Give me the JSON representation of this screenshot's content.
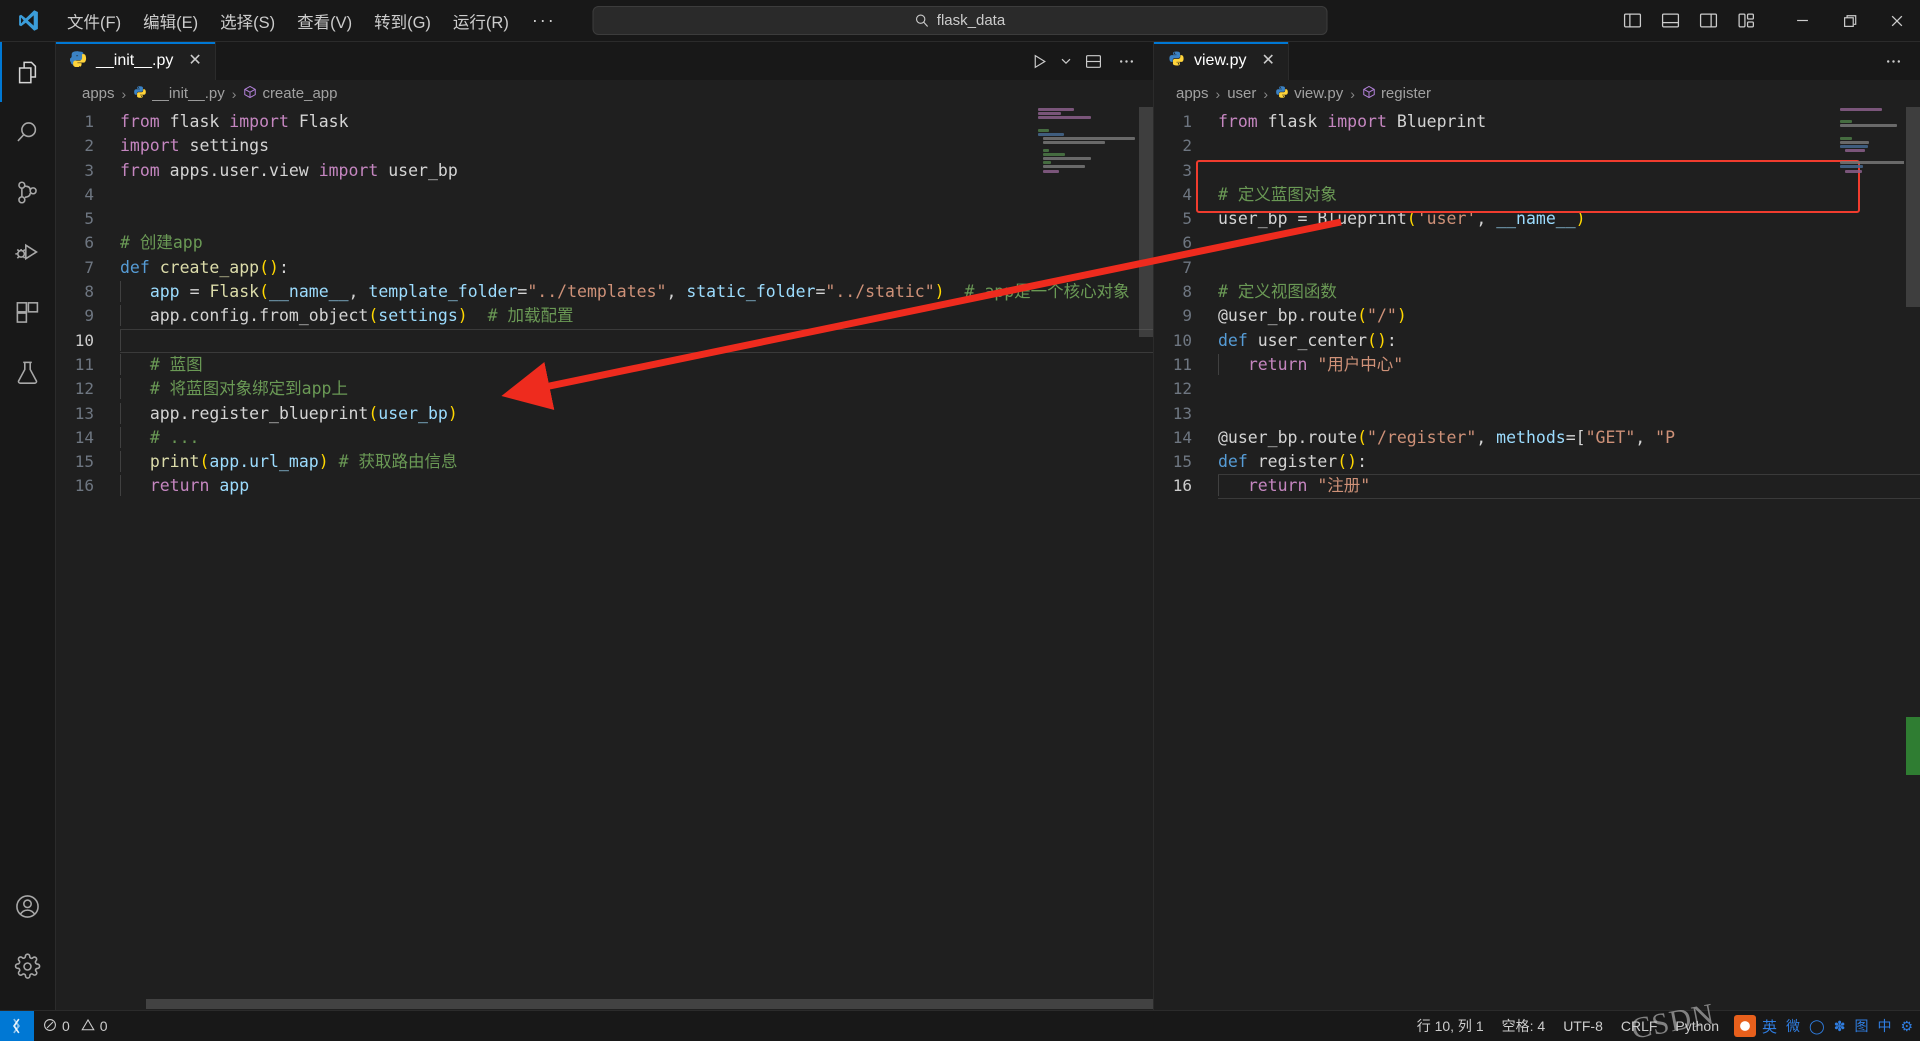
{
  "titlebar": {
    "logo_icon": "vscode-logo-icon",
    "menu": [
      {
        "label": "文件(F)",
        "name": "menu-file"
      },
      {
        "label": "编辑(E)",
        "name": "menu-edit"
      },
      {
        "label": "选择(S)",
        "name": "menu-selection"
      },
      {
        "label": "查看(V)",
        "name": "menu-view"
      },
      {
        "label": "转到(G)",
        "name": "menu-goto"
      },
      {
        "label": "运行(R)",
        "name": "menu-run"
      }
    ],
    "more_label": "···",
    "back_arrow": "←",
    "forward_arrow": "→",
    "command_center": {
      "icon": "search-icon",
      "text": "flask_data"
    },
    "layout_buttons": [
      {
        "name": "toggle-primary-sidebar-icon"
      },
      {
        "name": "toggle-panel-icon"
      },
      {
        "name": "toggle-secondary-sidebar-icon"
      },
      {
        "name": "customize-layout-icon"
      }
    ],
    "window_controls": {
      "minimize": "—",
      "maximize": "❐",
      "close": "✕"
    }
  },
  "activitybar": {
    "items": [
      {
        "name": "activity-explorer",
        "icon": "files-icon",
        "active": true
      },
      {
        "name": "activity-search",
        "icon": "search-icon",
        "active": false
      },
      {
        "name": "activity-source-control",
        "icon": "source-control-icon",
        "active": false
      },
      {
        "name": "activity-run-debug",
        "icon": "run-and-debug-icon",
        "active": false
      },
      {
        "name": "activity-extensions",
        "icon": "extensions-icon",
        "active": false
      },
      {
        "name": "activity-testing",
        "icon": "beaker-icon",
        "active": false
      }
    ],
    "bottom": [
      {
        "name": "activity-accounts",
        "icon": "account-icon"
      },
      {
        "name": "activity-settings",
        "icon": "gear-icon"
      }
    ]
  },
  "left_pane": {
    "tab": {
      "label": "__init__.py",
      "icon": "python-file-icon",
      "close": "✕"
    },
    "actions": [
      {
        "name": "run-python-file-button",
        "icon": "play-icon"
      },
      {
        "name": "run-dropdown-button",
        "icon": "chevron-down-icon"
      },
      {
        "name": "split-editor-down-button",
        "icon": "split-editor-icon"
      },
      {
        "name": "more-actions-button",
        "icon": "ellipsis-icon"
      }
    ],
    "breadcrumb": [
      {
        "label": "apps",
        "icon": null
      },
      {
        "label": "__init__.py",
        "icon": "python-file-icon"
      },
      {
        "label": "create_app",
        "icon": "symbol-method-icon"
      }
    ],
    "code_lines": [
      {
        "n": "1",
        "tokens": [
          {
            "t": "from ",
            "c": "kw"
          },
          {
            "t": "flask ",
            "c": "plain"
          },
          {
            "t": "import ",
            "c": "kw"
          },
          {
            "t": "Flask",
            "c": "plain"
          }
        ]
      },
      {
        "n": "2",
        "tokens": [
          {
            "t": "import ",
            "c": "kw"
          },
          {
            "t": "settings",
            "c": "plain"
          }
        ]
      },
      {
        "n": "3",
        "tokens": [
          {
            "t": "from ",
            "c": "kw"
          },
          {
            "t": "apps.user.view ",
            "c": "plain"
          },
          {
            "t": "import ",
            "c": "kw"
          },
          {
            "t": "user_bp",
            "c": "plain"
          }
        ]
      },
      {
        "n": "4",
        "tokens": []
      },
      {
        "n": "5",
        "tokens": []
      },
      {
        "n": "6",
        "tokens": [
          {
            "t": "# 创建app",
            "c": "com"
          }
        ]
      },
      {
        "n": "7",
        "tokens": [
          {
            "t": "def ",
            "c": "kw2"
          },
          {
            "t": "create_app",
            "c": "fn"
          },
          {
            "t": "()",
            "c": "par"
          },
          {
            "t": ":",
            "c": "plain"
          }
        ]
      },
      {
        "n": "8",
        "indent": 1,
        "tokens": [
          {
            "t": "app ",
            "c": "var"
          },
          {
            "t": "= ",
            "c": "plain"
          },
          {
            "t": "Flask",
            "c": "fn"
          },
          {
            "t": "(",
            "c": "par"
          },
          {
            "t": "__name__",
            "c": "var"
          },
          {
            "t": ", ",
            "c": "plain"
          },
          {
            "t": "template_folder",
            "c": "var"
          },
          {
            "t": "=",
            "c": "plain"
          },
          {
            "t": "\"../templates\"",
            "c": "str"
          },
          {
            "t": ", ",
            "c": "plain"
          },
          {
            "t": "static_folder",
            "c": "var"
          },
          {
            "t": "=",
            "c": "plain"
          },
          {
            "t": "\"../static\"",
            "c": "str"
          },
          {
            "t": ")",
            "c": "par"
          },
          {
            "t": "  # app是一个核心对象",
            "c": "com"
          }
        ]
      },
      {
        "n": "9",
        "indent": 1,
        "tokens": [
          {
            "t": "app.config.from_object",
            "c": "plain"
          },
          {
            "t": "(",
            "c": "par"
          },
          {
            "t": "settings",
            "c": "var"
          },
          {
            "t": ")",
            "c": "par"
          },
          {
            "t": "  # 加载配置",
            "c": "com"
          }
        ]
      },
      {
        "n": "10",
        "indent": 1,
        "tokens": [],
        "current": true
      },
      {
        "n": "11",
        "indent": 1,
        "tokens": [
          {
            "t": "# 蓝图",
            "c": "com"
          }
        ]
      },
      {
        "n": "12",
        "indent": 1,
        "tokens": [
          {
            "t": "# 将蓝图对象绑定到app上",
            "c": "com"
          }
        ]
      },
      {
        "n": "13",
        "indent": 1,
        "tokens": [
          {
            "t": "app.register_blueprint",
            "c": "plain"
          },
          {
            "t": "(",
            "c": "par"
          },
          {
            "t": "user_bp",
            "c": "var"
          },
          {
            "t": ")",
            "c": "par"
          }
        ]
      },
      {
        "n": "14",
        "indent": 1,
        "tokens": [
          {
            "t": "# ...",
            "c": "com"
          }
        ]
      },
      {
        "n": "15",
        "indent": 1,
        "tokens": [
          {
            "t": "print",
            "c": "fn"
          },
          {
            "t": "(",
            "c": "par"
          },
          {
            "t": "app.url_map",
            "c": "var"
          },
          {
            "t": ")",
            "c": "par"
          },
          {
            "t": " # 获取路由信息",
            "c": "com"
          }
        ]
      },
      {
        "n": "16",
        "indent": 1,
        "tokens": [
          {
            "t": "return ",
            "c": "kw"
          },
          {
            "t": "app",
            "c": "var"
          }
        ]
      }
    ]
  },
  "right_pane": {
    "tab": {
      "label": "view.py",
      "icon": "python-file-icon",
      "close": "✕"
    },
    "actions": [
      {
        "name": "more-actions-button",
        "icon": "ellipsis-icon"
      }
    ],
    "breadcrumb": [
      {
        "label": "apps",
        "icon": null
      },
      {
        "label": "user",
        "icon": null
      },
      {
        "label": "view.py",
        "icon": "python-file-icon"
      },
      {
        "label": "register",
        "icon": "symbol-method-icon"
      }
    ],
    "code_lines": [
      {
        "n": "1",
        "tokens": [
          {
            "t": "from ",
            "c": "kw"
          },
          {
            "t": "flask ",
            "c": "plain"
          },
          {
            "t": "import ",
            "c": "kw"
          },
          {
            "t": "Blueprint",
            "c": "plain"
          }
        ]
      },
      {
        "n": "2",
        "tokens": []
      },
      {
        "n": "3",
        "tokens": []
      },
      {
        "n": "4",
        "tokens": [
          {
            "t": "# 定义蓝图对象",
            "c": "com"
          }
        ]
      },
      {
        "n": "5",
        "tokens": [
          {
            "t": "user_bp ",
            "c": "plain"
          },
          {
            "t": "= ",
            "c": "plain"
          },
          {
            "t": "Blueprint",
            "c": "plain"
          },
          {
            "t": "(",
            "c": "par"
          },
          {
            "t": "'user'",
            "c": "str"
          },
          {
            "t": ", ",
            "c": "plain"
          },
          {
            "t": "__name__",
            "c": "var"
          },
          {
            "t": ")",
            "c": "par"
          }
        ]
      },
      {
        "n": "6",
        "tokens": []
      },
      {
        "n": "7",
        "tokens": []
      },
      {
        "n": "8",
        "tokens": [
          {
            "t": "# 定义视图函数",
            "c": "com"
          }
        ]
      },
      {
        "n": "9",
        "tokens": [
          {
            "t": "@user_bp.route",
            "c": "plain"
          },
          {
            "t": "(",
            "c": "par"
          },
          {
            "t": "\"/\"",
            "c": "str"
          },
          {
            "t": ")",
            "c": "par"
          }
        ]
      },
      {
        "n": "10",
        "tokens": [
          {
            "t": "def ",
            "c": "kw2"
          },
          {
            "t": "user_center",
            "c": "plain"
          },
          {
            "t": "()",
            "c": "par"
          },
          {
            "t": ":",
            "c": "plain"
          }
        ]
      },
      {
        "n": "11",
        "indent": 1,
        "tokens": [
          {
            "t": "return ",
            "c": "kw"
          },
          {
            "t": "\"用户中心\"",
            "c": "str"
          }
        ]
      },
      {
        "n": "12",
        "tokens": []
      },
      {
        "n": "13",
        "tokens": []
      },
      {
        "n": "14",
        "tokens": [
          {
            "t": "@user_bp.route",
            "c": "plain"
          },
          {
            "t": "(",
            "c": "par"
          },
          {
            "t": "\"/register\"",
            "c": "str"
          },
          {
            "t": ", ",
            "c": "plain"
          },
          {
            "t": "methods",
            "c": "var"
          },
          {
            "t": "=[",
            "c": "plain"
          },
          {
            "t": "\"GET\"",
            "c": "str"
          },
          {
            "t": ", ",
            "c": "plain"
          },
          {
            "t": "\"P",
            "c": "str"
          }
        ]
      },
      {
        "n": "15",
        "tokens": [
          {
            "t": "def ",
            "c": "kw2"
          },
          {
            "t": "register",
            "c": "plain"
          },
          {
            "t": "()",
            "c": "par"
          },
          {
            "t": ":",
            "c": "plain"
          }
        ]
      },
      {
        "n": "16",
        "indent": 1,
        "tokens": [
          {
            "t": "return ",
            "c": "kw"
          },
          {
            "t": "\"注册\"",
            "c": "str"
          }
        ],
        "current": true
      }
    ],
    "highlight_color": "#f03c2e"
  },
  "annotation": {
    "arrow_color": "#ee2b1e",
    "description": "red-arrow-from-view-py-line5-to-init-py-line13"
  },
  "statusbar": {
    "remote_icon": "remote-window-icon",
    "problems": {
      "errors_icon": "error-icon",
      "errors": "0",
      "warnings_icon": "warning-icon",
      "warnings": "0"
    },
    "right_items": [
      {
        "name": "editor-position",
        "label": "行 10, 列 1"
      },
      {
        "name": "editor-indentation",
        "label": "空格: 4"
      },
      {
        "name": "editor-encoding",
        "label": "UTF-8"
      },
      {
        "name": "editor-eol",
        "label": "CRLF"
      },
      {
        "name": "editor-language",
        "label": "Python"
      }
    ],
    "ime": {
      "mode": "英",
      "items": [
        "微",
        "◯",
        "✽",
        "图",
        "中",
        "⚙"
      ]
    },
    "watermark": "CSDN"
  }
}
